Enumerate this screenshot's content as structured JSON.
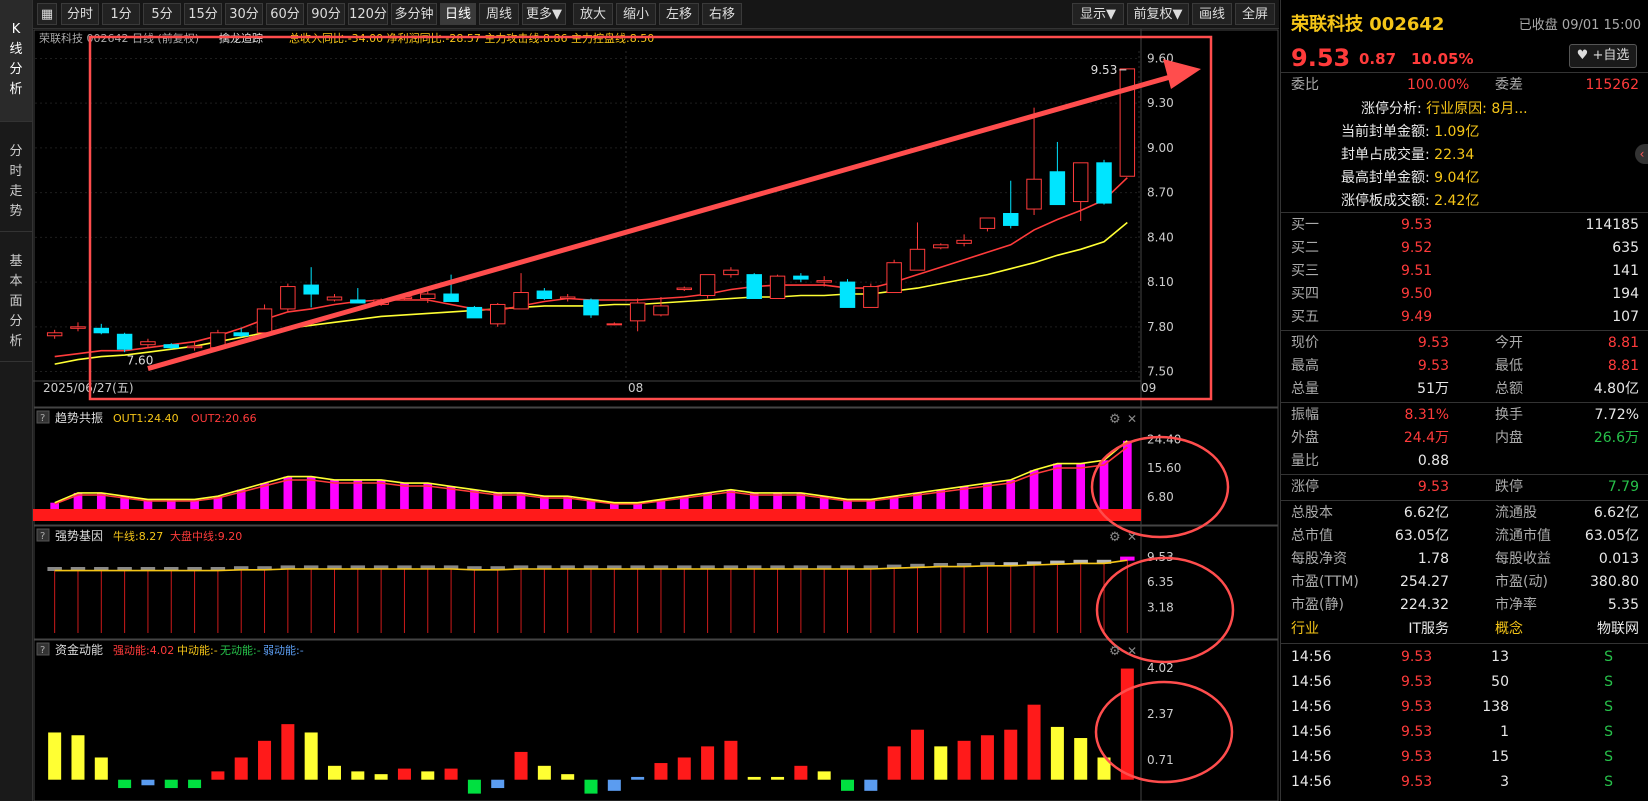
{
  "left_tabs": [
    {
      "label": "K线分析",
      "active": true
    },
    {
      "label": "分时走势",
      "active": false
    },
    {
      "label": "基本面分析",
      "active": false
    }
  ],
  "toolbar": {
    "periods": [
      "分时",
      "1分",
      "5分",
      "15分",
      "30分",
      "60分",
      "90分",
      "120分",
      "多分钟",
      "日线",
      "周线",
      "更多▼"
    ],
    "active_period": "日线",
    "actions": [
      "放大",
      "缩小",
      "左移",
      "右移"
    ],
    "right": [
      "显示▼",
      "前复权▼",
      "画线",
      "全屏"
    ]
  },
  "chart_data": [
    {
      "type": "candlestick",
      "title": "荣联科技 002642 日线 (前复权)",
      "indicator_name": "擒龙追踪",
      "indicator_values": "总收入同比:-34.00 净利润同比:-28.57 主力攻击线:8.86",
      "indicator_value2": "主力控盘线:8.50",
      "ylim": [
        7.45,
        9.65
      ],
      "yticks": [
        9.6,
        9.3,
        9.0,
        8.7,
        8.4,
        8.1,
        7.8,
        7.5
      ],
      "x_labels": [
        "2025/06/27(五)",
        "08",
        "09"
      ],
      "max_label": "9.53",
      "min_label": "7.60",
      "candles": [
        {
          "o": 7.74,
          "h": 7.78,
          "l": 7.72,
          "c": 7.76
        },
        {
          "o": 7.79,
          "h": 7.83,
          "l": 7.77,
          "c": 7.8
        },
        {
          "o": 7.79,
          "h": 7.82,
          "l": 7.75,
          "c": 7.76
        },
        {
          "o": 7.75,
          "h": 7.76,
          "l": 7.63,
          "c": 7.65
        },
        {
          "o": 7.68,
          "h": 7.72,
          "l": 7.66,
          "c": 7.7
        },
        {
          "o": 7.68,
          "h": 7.69,
          "l": 7.65,
          "c": 7.66
        },
        {
          "o": 7.66,
          "h": 7.7,
          "l": 7.64,
          "c": 7.67
        },
        {
          "o": 7.66,
          "h": 7.78,
          "l": 7.65,
          "c": 7.76
        },
        {
          "o": 7.76,
          "h": 7.79,
          "l": 7.73,
          "c": 7.74
        },
        {
          "o": 7.76,
          "h": 7.95,
          "l": 7.75,
          "c": 7.92
        },
        {
          "o": 7.92,
          "h": 8.09,
          "l": 7.9,
          "c": 8.07
        },
        {
          "o": 8.08,
          "h": 8.2,
          "l": 7.93,
          "c": 8.02
        },
        {
          "o": 7.98,
          "h": 8.02,
          "l": 7.97,
          "c": 8.0
        },
        {
          "o": 7.98,
          "h": 8.06,
          "l": 7.96,
          "c": 7.96
        },
        {
          "o": 7.95,
          "h": 7.99,
          "l": 7.94,
          "c": 7.98
        },
        {
          "o": 7.99,
          "h": 8.02,
          "l": 7.98,
          "c": 8.0
        },
        {
          "o": 7.99,
          "h": 8.05,
          "l": 7.96,
          "c": 8.02
        },
        {
          "o": 8.02,
          "h": 8.15,
          "l": 7.97,
          "c": 7.97
        },
        {
          "o": 7.93,
          "h": 7.94,
          "l": 7.86,
          "c": 7.86
        },
        {
          "o": 7.82,
          "h": 7.96,
          "l": 7.8,
          "c": 7.95
        },
        {
          "o": 7.92,
          "h": 8.16,
          "l": 7.92,
          "c": 8.03
        },
        {
          "o": 8.04,
          "h": 8.06,
          "l": 7.98,
          "c": 7.99
        },
        {
          "o": 7.99,
          "h": 8.02,
          "l": 7.97,
          "c": 8.0
        },
        {
          "o": 7.98,
          "h": 7.99,
          "l": 7.86,
          "c": 7.88
        },
        {
          "o": 7.82,
          "h": 7.83,
          "l": 7.81,
          "c": 7.82
        },
        {
          "o": 7.84,
          "h": 7.99,
          "l": 7.77,
          "c": 7.96
        },
        {
          "o": 7.88,
          "h": 8.0,
          "l": 7.87,
          "c": 7.94
        },
        {
          "o": 8.05,
          "h": 8.07,
          "l": 8.04,
          "c": 8.06
        },
        {
          "o": 8.01,
          "h": 8.15,
          "l": 7.99,
          "c": 8.15
        },
        {
          "o": 8.15,
          "h": 8.2,
          "l": 8.13,
          "c": 8.18
        },
        {
          "o": 8.15,
          "h": 8.16,
          "l": 8.0,
          "c": 7.99
        },
        {
          "o": 7.99,
          "h": 8.15,
          "l": 7.99,
          "c": 8.14
        },
        {
          "o": 8.14,
          "h": 8.16,
          "l": 8.1,
          "c": 8.12
        },
        {
          "o": 8.1,
          "h": 8.14,
          "l": 8.07,
          "c": 8.11
        },
        {
          "o": 8.1,
          "h": 8.12,
          "l": 7.94,
          "c": 7.93
        },
        {
          "o": 7.93,
          "h": 8.09,
          "l": 7.93,
          "c": 8.07
        },
        {
          "o": 8.03,
          "h": 8.25,
          "l": 8.03,
          "c": 8.23
        },
        {
          "o": 8.18,
          "h": 8.5,
          "l": 8.18,
          "c": 8.32
        },
        {
          "o": 8.33,
          "h": 8.36,
          "l": 8.32,
          "c": 8.35
        },
        {
          "o": 8.36,
          "h": 8.42,
          "l": 8.34,
          "c": 8.38
        },
        {
          "o": 8.46,
          "h": 8.53,
          "l": 8.44,
          "c": 8.53
        },
        {
          "o": 8.56,
          "h": 8.78,
          "l": 8.46,
          "c": 8.48
        },
        {
          "o": 8.59,
          "h": 9.27,
          "l": 8.55,
          "c": 8.79
        },
        {
          "o": 8.84,
          "h": 9.04,
          "l": 8.62,
          "c": 8.62
        },
        {
          "o": 8.64,
          "h": 8.9,
          "l": 8.51,
          "c": 8.9
        },
        {
          "o": 8.9,
          "h": 8.92,
          "l": 8.62,
          "c": 8.63
        },
        {
          "o": 8.81,
          "h": 9.53,
          "l": 8.81,
          "c": 9.53
        }
      ],
      "ma_red": [
        7.6,
        7.62,
        7.64,
        7.64,
        7.66,
        7.68,
        7.7,
        7.74,
        7.79,
        7.85,
        7.9,
        7.92,
        7.95,
        7.97,
        7.98,
        7.98,
        7.98,
        7.95,
        7.92,
        7.91,
        7.94,
        7.97,
        7.99,
        7.98,
        7.98,
        7.98,
        7.99,
        8.0,
        8.02,
        8.05,
        8.07,
        8.08,
        8.08,
        8.08,
        8.06,
        8.06,
        8.1,
        8.15,
        8.2,
        8.25,
        8.3,
        8.35,
        8.45,
        8.52,
        8.58,
        8.65,
        8.8
      ],
      "ma_yellow": [
        7.55,
        7.58,
        7.6,
        7.61,
        7.63,
        7.65,
        7.67,
        7.7,
        7.73,
        7.76,
        7.79,
        7.81,
        7.83,
        7.85,
        7.87,
        7.88,
        7.89,
        7.9,
        7.91,
        7.92,
        7.93,
        7.94,
        7.94,
        7.94,
        7.95,
        7.95,
        7.96,
        7.97,
        7.98,
        7.99,
        8.0,
        8.0,
        8.01,
        8.01,
        8.02,
        8.02,
        8.04,
        8.06,
        8.09,
        8.12,
        8.15,
        8.19,
        8.23,
        8.28,
        8.32,
        8.37,
        8.5
      ]
    },
    {
      "type": "bar",
      "title": "趋势共振",
      "series_labels": [
        "OUT1:24.40",
        "OUT2:20.66"
      ],
      "yticks": [
        "24.40",
        "15.60",
        "6.80"
      ],
      "ylim": [
        0,
        27
      ],
      "values": [
        5,
        8,
        8,
        7,
        6,
        6,
        6,
        7,
        9,
        11,
        13,
        13,
        12,
        12,
        12,
        11,
        11,
        10,
        9,
        8,
        8,
        7,
        7,
        6,
        5,
        5,
        6,
        7,
        8,
        9,
        8,
        8,
        8,
        7,
        6,
        6,
        7,
        8,
        9,
        10,
        11,
        12,
        15,
        17,
        17,
        18,
        24
      ]
    },
    {
      "type": "bar",
      "title": "强势基因",
      "series_labels": [
        "牛线:8.27",
        "大盘中线:9.20"
      ],
      "yticks": [
        "9.53",
        "6.35",
        "3.18"
      ],
      "ylim": [
        0,
        10.5
      ],
      "values": [
        8.0,
        8.0,
        8.0,
        8.0,
        8.0,
        8.0,
        8.0,
        8.0,
        8.1,
        8.1,
        8.2,
        8.2,
        8.2,
        8.2,
        8.2,
        8.2,
        8.2,
        8.2,
        8.1,
        8.1,
        8.2,
        8.2,
        8.2,
        8.2,
        8.2,
        8.2,
        8.2,
        8.2,
        8.2,
        8.2,
        8.2,
        8.2,
        8.2,
        8.2,
        8.2,
        8.2,
        8.3,
        8.4,
        8.5,
        8.5,
        8.6,
        8.6,
        8.7,
        8.8,
        8.9,
        8.9,
        9.3
      ]
    },
    {
      "type": "bar",
      "title": "资金动能",
      "series_labels": [
        "强动能:4.02",
        "中动能:-",
        "无动能:-",
        "弱动能:-"
      ],
      "yticks": [
        "4.02",
        "2.37",
        "0.71"
      ],
      "ylim": [
        -0.55,
        4.2
      ],
      "values": [
        1.7,
        1.6,
        0.8,
        -0.3,
        -0.2,
        -0.3,
        -0.3,
        0.3,
        0.8,
        1.4,
        2.0,
        1.7,
        0.5,
        0.3,
        0.2,
        0.4,
        0.3,
        0.4,
        -0.5,
        -0.3,
        1.0,
        0.5,
        0.2,
        -0.5,
        -0.4,
        0.1,
        0.6,
        0.8,
        1.2,
        1.4,
        0.1,
        0.1,
        0.5,
        0.3,
        -0.4,
        -0.4,
        1.2,
        1.8,
        1.2,
        1.4,
        1.6,
        1.8,
        2.7,
        1.9,
        1.5,
        0.8,
        4.0
      ],
      "colors": [
        "yellow",
        "yellow",
        "yellow",
        "green",
        "blue",
        "green",
        "green",
        "red",
        "red",
        "red",
        "red",
        "yellow",
        "yellow",
        "yellow",
        "yellow",
        "red",
        "yellow",
        "red",
        "green",
        "blue",
        "red",
        "yellow",
        "yellow",
        "green",
        "blue",
        "blue",
        "red",
        "red",
        "red",
        "red",
        "yellow",
        "yellow",
        "red",
        "yellow",
        "green",
        "blue",
        "red",
        "red",
        "yellow",
        "red",
        "red",
        "red",
        "red",
        "yellow",
        "yellow",
        "yellow",
        "red"
      ]
    }
  ],
  "quote": {
    "title": "荣联科技 002642",
    "status": "已收盘 09/01 15:00",
    "price": "9.53",
    "change": "0.87",
    "pct": "10.05%",
    "add_btn": "+自选",
    "weibi_label": "委比",
    "weibi": "100.00%",
    "weicha_label": "委差",
    "weicha": "115262",
    "limit_info": [
      {
        "label": "涨停分析:",
        "value": "行业原因: 8月..."
      },
      {
        "label": "当前封单金额:",
        "value": "1.09亿"
      },
      {
        "label": "封单占成交量:",
        "value": "22.34"
      },
      {
        "label": "最高封单金额:",
        "value": "9.04亿"
      },
      {
        "label": "涨停板成交额:",
        "value": "2.42亿"
      }
    ],
    "bids": [
      {
        "label": "买一",
        "price": "9.53",
        "vol": "114185"
      },
      {
        "label": "买二",
        "price": "9.52",
        "vol": "635"
      },
      {
        "label": "买三",
        "price": "9.51",
        "vol": "141"
      },
      {
        "label": "买四",
        "price": "9.50",
        "vol": "194"
      },
      {
        "label": "买五",
        "price": "9.49",
        "vol": "107"
      }
    ],
    "stats": [
      {
        "l1": "现价",
        "v1": "9.53",
        "c1": "red",
        "l2": "今开",
        "v2": "8.81",
        "c2": "red"
      },
      {
        "l1": "最高",
        "v1": "9.53",
        "c1": "red",
        "l2": "最低",
        "v2": "8.81",
        "c2": "red"
      },
      {
        "l1": "总量",
        "v1": "51万",
        "c1": "white",
        "l2": "总额",
        "v2": "4.80亿",
        "c2": "white"
      }
    ],
    "stats2": [
      {
        "l1": "振幅",
        "v1": "8.31%",
        "c1": "red",
        "l2": "换手",
        "v2": "7.72%",
        "c2": "white"
      },
      {
        "l1": "外盘",
        "v1": "24.4万",
        "c1": "red",
        "l2": "内盘",
        "v2": "26.6万",
        "c2": "green"
      },
      {
        "l1": "量比",
        "v1": "0.88",
        "c1": "white",
        "l2": "",
        "v2": "",
        "c2": "white"
      }
    ],
    "stats3": [
      {
        "l1": "涨停",
        "v1": "9.53",
        "c1": "red",
        "l2": "跌停",
        "v2": "7.79",
        "c2": "green"
      }
    ],
    "fundamentals": [
      {
        "l1": "总股本",
        "v1": "6.62亿",
        "l2": "流通股",
        "v2": "6.62亿"
      },
      {
        "l1": "总市值",
        "v1": "63.05亿",
        "l2": "流通市值",
        "v2": "63.05亿"
      },
      {
        "l1": "每股净资",
        "v1": "1.78",
        "l2": "每股收益",
        "v2": "0.013"
      },
      {
        "l1": "市盈(TTM)",
        "v1": "254.27",
        "l2": "市盈(动)",
        "v2": "380.80"
      },
      {
        "l1": "市盈(静)",
        "v1": "224.32",
        "l2": "市净率",
        "v2": "5.35"
      }
    ],
    "industry": {
      "l1": "行业",
      "v1": "IT服务",
      "l2": "概念",
      "v2": "物联网"
    },
    "ticks": [
      {
        "time": "14:56",
        "price": "9.53",
        "vol": "13",
        "side": "S"
      },
      {
        "time": "14:56",
        "price": "9.53",
        "vol": "50",
        "side": "S"
      },
      {
        "time": "14:56",
        "price": "9.53",
        "vol": "138",
        "side": "S"
      },
      {
        "time": "14:56",
        "price": "9.53",
        "vol": "1",
        "side": "S"
      },
      {
        "time": "14:56",
        "price": "9.53",
        "vol": "15",
        "side": "S"
      },
      {
        "time": "14:56",
        "price": "9.53",
        "vol": "3",
        "side": "S"
      }
    ]
  },
  "colors": {
    "up": "#ff3b3b",
    "down": "#00e5ff",
    "ma_red": "#ff3b3b",
    "ma_yellow": "#ffff33",
    "magenta": "#ff00ff",
    "annotation": "#ff4d4d",
    "green": "#00e040",
    "blue": "#5b9cf0",
    "yellow": "#ffff33"
  }
}
